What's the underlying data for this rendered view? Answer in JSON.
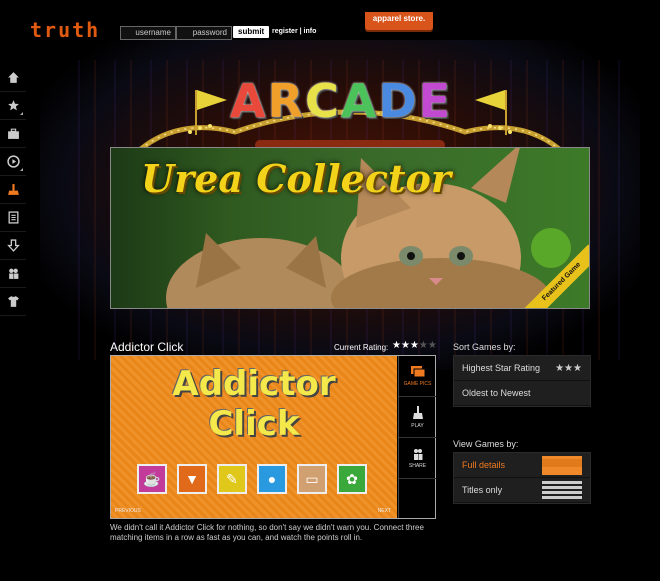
{
  "header": {
    "logo_text": "truth",
    "username_placeholder": "username",
    "password_placeholder": "password",
    "submit_label": "submit",
    "register_info": "register | info",
    "apparel_label": "apparel store."
  },
  "sidebar": {
    "items": [
      {
        "icon": "home-icon"
      },
      {
        "icon": "star-icon"
      },
      {
        "icon": "briefcase-icon"
      },
      {
        "icon": "play-icon"
      },
      {
        "icon": "broom-icon",
        "active": true
      },
      {
        "icon": "document-icon"
      },
      {
        "icon": "download-arrow-icon"
      },
      {
        "icon": "people-icon"
      },
      {
        "icon": "tshirt-icon"
      }
    ]
  },
  "marquee": {
    "title": "ARCADE",
    "letter_colors": [
      "#e8493a",
      "#f0a02a",
      "#e7e14a",
      "#4cc25a",
      "#4a8ae0",
      "#c24ad0"
    ]
  },
  "featured": {
    "title": "Urea Collector",
    "ribbon": "Featured Game"
  },
  "game": {
    "title": "Addictor Click",
    "rating_label": "Current Rating:",
    "rating": 3,
    "rating_max": 5,
    "screenshot_line1": "Addictor",
    "screenshot_line2": "Click",
    "previous": "PREVIOUS",
    "next": "NEXT",
    "side_buttons": [
      {
        "label": "GAME PICS",
        "icon": "photos-icon",
        "active": true
      },
      {
        "label": "PLAY",
        "icon": "broom-icon"
      },
      {
        "label": "SHARE",
        "icon": "people-icon"
      }
    ],
    "tiles": [
      {
        "icon": "cup-icon",
        "color": "#c23a9a"
      },
      {
        "icon": "carrot-icon",
        "color": "#e06a1a"
      },
      {
        "icon": "pencil-icon",
        "color": "#e0c81a"
      },
      {
        "icon": "circles-icon",
        "color": "#2a9ae0"
      },
      {
        "icon": "bread-icon",
        "color": "#d0a070"
      },
      {
        "icon": "basket-icon",
        "color": "#3aa83a"
      }
    ],
    "description": "We didn't call it Addictor Click for nothing, so don't say we didn't warn you. Connect three matching items in a row as fast as you can, and watch the points roll in."
  },
  "sort": {
    "heading": "Sort Games by:",
    "items": [
      {
        "label": "Highest Star Rating",
        "stars": "★★★"
      },
      {
        "label": "Oldest to Newest"
      }
    ]
  },
  "view": {
    "heading": "View Games by:",
    "items": [
      {
        "label": "Full details",
        "active": true
      },
      {
        "label": "Titles only"
      }
    ]
  }
}
